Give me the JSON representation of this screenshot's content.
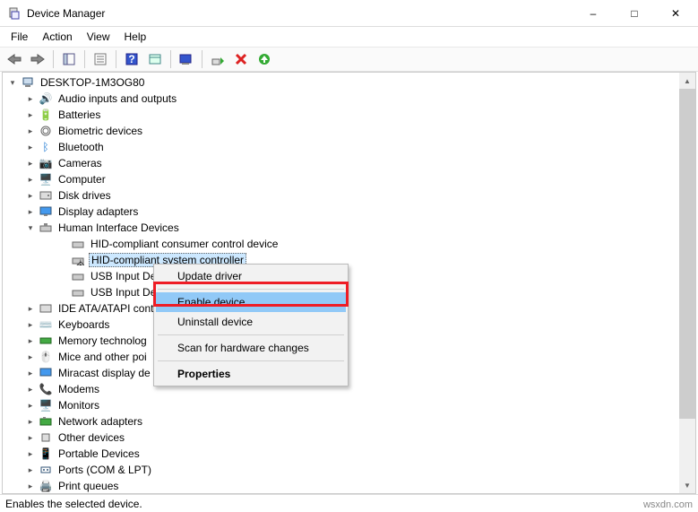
{
  "window": {
    "title": "Device Manager"
  },
  "menu": {
    "file": "File",
    "action": "Action",
    "view": "View",
    "help": "Help"
  },
  "status": {
    "text": "Enables the selected device."
  },
  "watermark": "wsxdn.com",
  "tree": {
    "root": "DESKTOP-1M3OG80",
    "items": [
      "Audio inputs and outputs",
      "Batteries",
      "Biometric devices",
      "Bluetooth",
      "Cameras",
      "Computer",
      "Disk drives",
      "Display adapters"
    ],
    "hid": {
      "label": "Human Interface Devices",
      "children": [
        "HID-compliant consumer control device",
        "HID-compliant system controller",
        "USB Input Devic",
        "USB Input Devic"
      ]
    },
    "after": [
      "IDE ATA/ATAPI cont",
      "Keyboards",
      "Memory technolog",
      "Mice and other poi",
      "Miracast display de",
      "Modems",
      "Monitors",
      "Network adapters",
      "Other devices",
      "Portable Devices",
      "Ports (COM & LPT)",
      "Print queues"
    ]
  },
  "context": {
    "update": "Update driver",
    "enable": "Enable device",
    "uninstall": "Uninstall device",
    "scan": "Scan for hardware changes",
    "properties": "Properties"
  }
}
